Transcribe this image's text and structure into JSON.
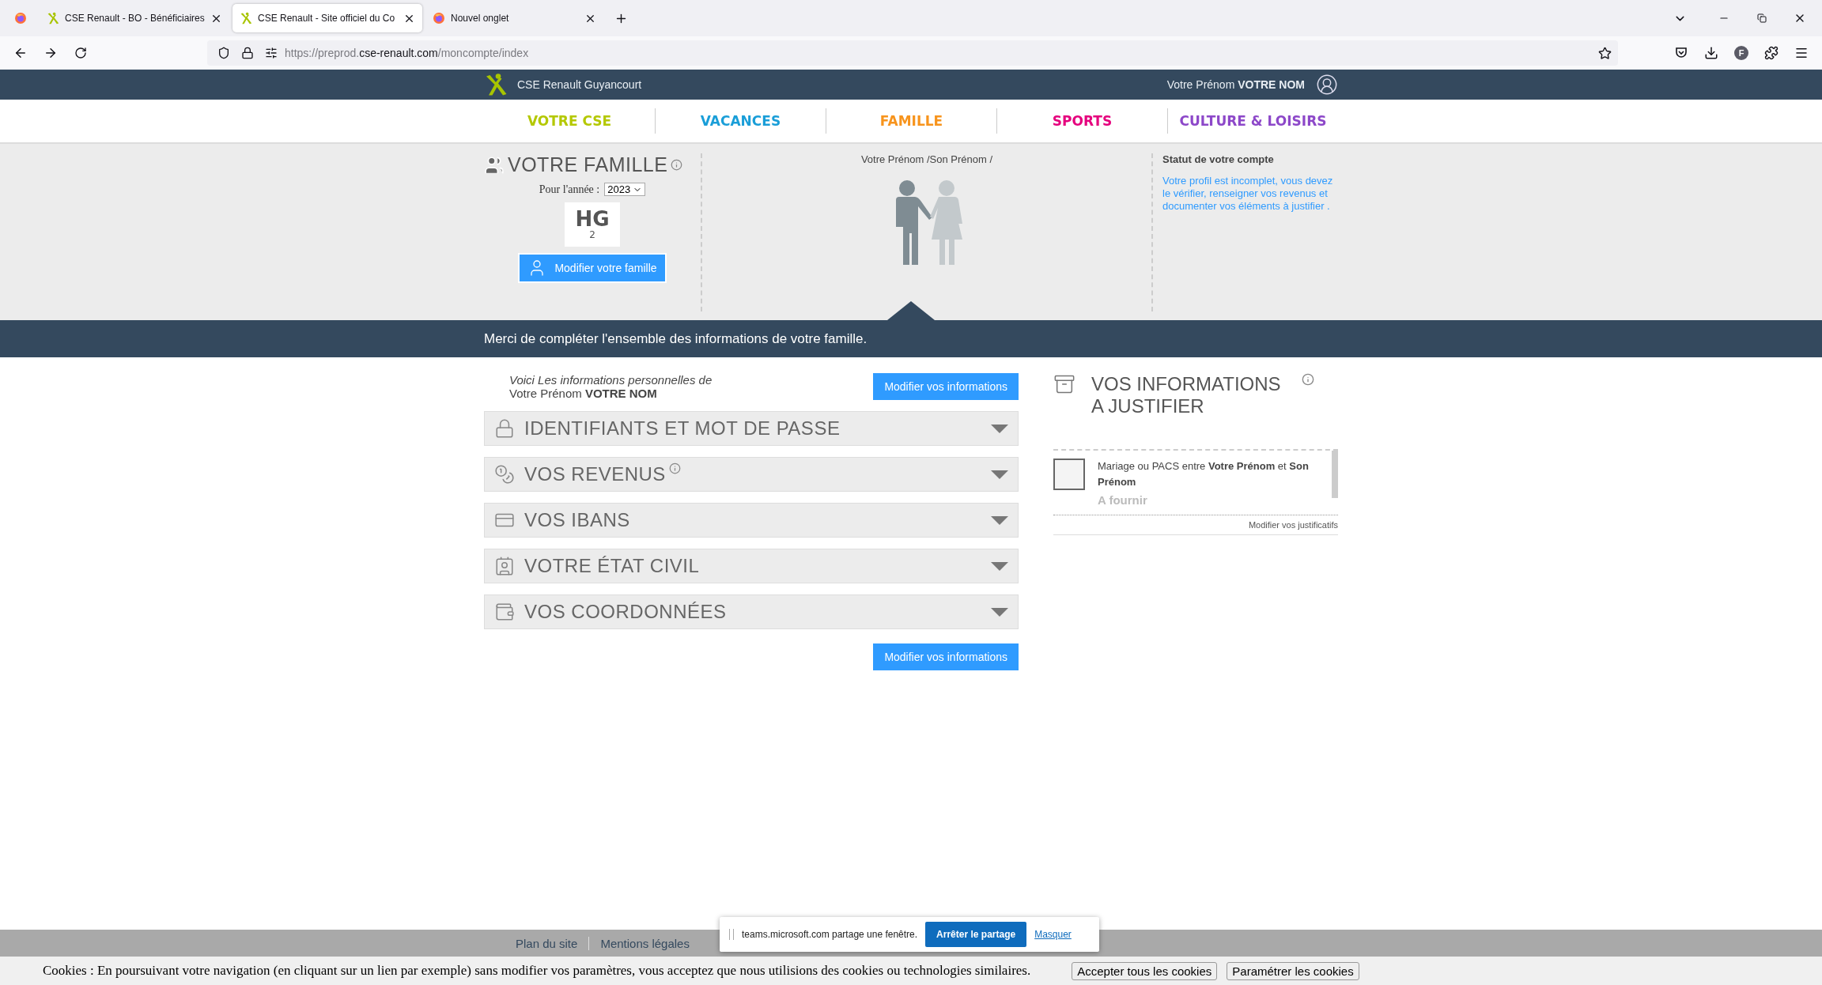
{
  "browser": {
    "tabs": [
      {
        "title": "CSE Renault - BO - Bénéficiaires",
        "kind": "page",
        "selected": false
      },
      {
        "title": "CSE Renault - Site officiel du Co",
        "kind": "page",
        "selected": true
      },
      {
        "title": "Nouvel onglet",
        "kind": "blank",
        "selected": false
      }
    ],
    "url": {
      "prefix": "https://preprod.",
      "domain": "cse-renault.com",
      "path": "/moncompte/index"
    },
    "profile_initial": "F"
  },
  "header": {
    "site_name": "CSE Renault Guyancourt",
    "user": "Votre Prénom **VOTRE NOM**"
  },
  "nav": [
    {
      "label": "VOTRE CSE",
      "color": "#b4c800"
    },
    {
      "label": "VACANCES",
      "color": "#1a9ed8"
    },
    {
      "label": "FAMILLE",
      "color": "#f7941d"
    },
    {
      "label": "SPORTS",
      "color": "#e5007d"
    },
    {
      "label": "CULTURE & LOISIRS",
      "color": "#8d48c9"
    }
  ],
  "family": {
    "title": "VOTRE FAMILLE",
    "year_label": "Pour l'année :",
    "year": "2023",
    "code": "HG",
    "count": "2",
    "edit_button": "Modifier votre famille",
    "members": "Votre Prénom /Son Prénom /",
    "status_title": "Statut de votre compte",
    "status_text": "Votre profil est incomplet, vous devez le vérifier, renseigner vos revenus et documenter vos éléments à justifier ."
  },
  "banner": "Merci de compléter l'ensemble des informations de votre famille.",
  "personal": {
    "intro": "Voici Les informations personnelles de",
    "name": "Votre Prénom **VOTRE NOM**",
    "edit_button_top": "Modifier vos informations",
    "edit_button_bottom": "Modifier vos informations",
    "sections": [
      {
        "kind": "lock",
        "label": "IDENTIFIANTS ET MOT DE PASSE",
        "info": false,
        "expanded": false
      },
      {
        "kind": "coins",
        "label": "VOS REVENUS",
        "info": true,
        "expanded": false
      },
      {
        "kind": "card",
        "label": "VOS IBANS",
        "info": false,
        "expanded": false
      },
      {
        "kind": "idcard",
        "label": "VOTRE ÉTAT CIVIL",
        "info": false,
        "expanded": false
      },
      {
        "kind": "wallet",
        "label": "VOS COORDONNÉES",
        "info": false,
        "expanded": false
      }
    ]
  },
  "justify": {
    "title_line1": "VOS INFORMATIONS",
    "title_line2": "A JUSTIFIER",
    "items": [
      {
        "text": "Mariage ou PACS entre **Votre Prénom** et **Son Prénom**",
        "status": "A fournir"
      }
    ],
    "link": "Modifier vos justificatifs"
  },
  "footer": {
    "links": [
      "Plan du site",
      "Mentions légales"
    ]
  },
  "share_popup": {
    "text": "teams.microsoft.com partage une fenêtre.",
    "stop_button": "Arrêter le partage",
    "hide_link": "Masquer"
  },
  "cookies": {
    "text": "Cookies : En poursuivant votre navigation (en cliquant sur un lien par exemple) sans modifier vos paramètres, vous acceptez que nous utilisions des cookies ou technologies similaires.",
    "accept_button": "Accepter tous les cookies",
    "settings_button": "Paramétrer les cookies"
  }
}
